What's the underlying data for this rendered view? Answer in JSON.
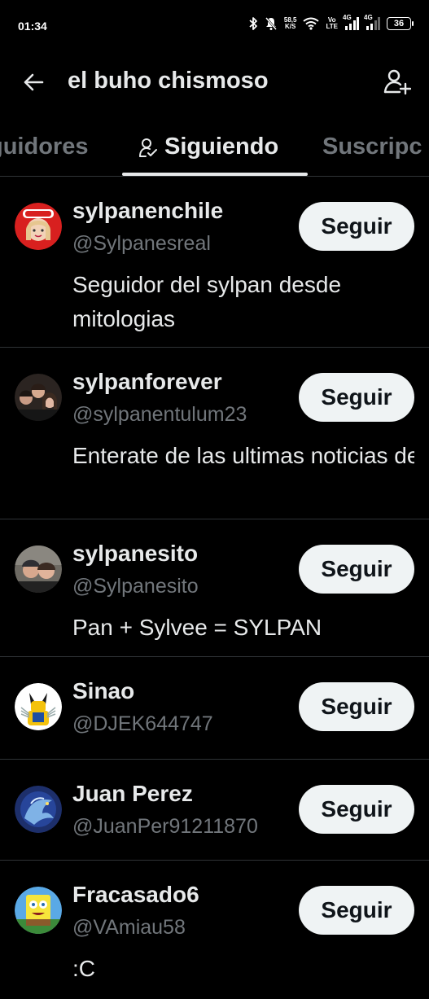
{
  "status_bar": {
    "time": "01:34",
    "speed_value": "58,5",
    "speed_unit": "K/S",
    "volte_top": "Vo",
    "volte_bottom": "LTE",
    "net1": "4G",
    "net2": "4G",
    "battery": "36",
    "icons": [
      "bluetooth-icon",
      "mute-icon",
      "wifi-icon",
      "signal-icon",
      "signal-icon",
      "battery-icon"
    ]
  },
  "header": {
    "title": "el buho chismoso",
    "back_icon": "arrow-left-icon",
    "action_icon": "add-person-icon"
  },
  "tabs": [
    {
      "label": "guidores",
      "active": false
    },
    {
      "label": "Siguiendo",
      "active": true,
      "icon": "person-check-icon"
    },
    {
      "label": "Suscripc",
      "active": false
    }
  ],
  "follow_label": "Seguir",
  "users": [
    {
      "name": "sylpanenchile",
      "handle": "@Sylpanesreal",
      "bio": "Seguidor del sylpan desde mitologias",
      "avatar": "avatar-rapiditas"
    },
    {
      "name": "sylpanforever",
      "handle": "@sylpanentulum23",
      "bio": "Enterate de las ultimas noticias del sylpan ya que e…",
      "avatar": "avatar-group-photo"
    },
    {
      "name": "sylpanesito",
      "handle": "@Sylpanesito",
      "bio": "Pan + Sylvee = SYLPAN",
      "avatar": "avatar-couple-photo"
    },
    {
      "name": "Sinao",
      "handle": "@DJEK644747",
      "bio": "",
      "avatar": "avatar-wolverine"
    },
    {
      "name": "Juan Perez",
      "handle": "@JuanPer91211870",
      "bio": "",
      "avatar": "avatar-dragon"
    },
    {
      "name": "Fracasado6",
      "handle": "@VAmiau58",
      "bio": ":C",
      "avatar": "avatar-spongebob"
    }
  ],
  "colors": {
    "background": "#000000",
    "text_primary": "#e7e9ea",
    "text_secondary": "#71767b",
    "divider": "#2f3336",
    "button_bg": "#eff3f4",
    "button_text": "#0f1419"
  }
}
